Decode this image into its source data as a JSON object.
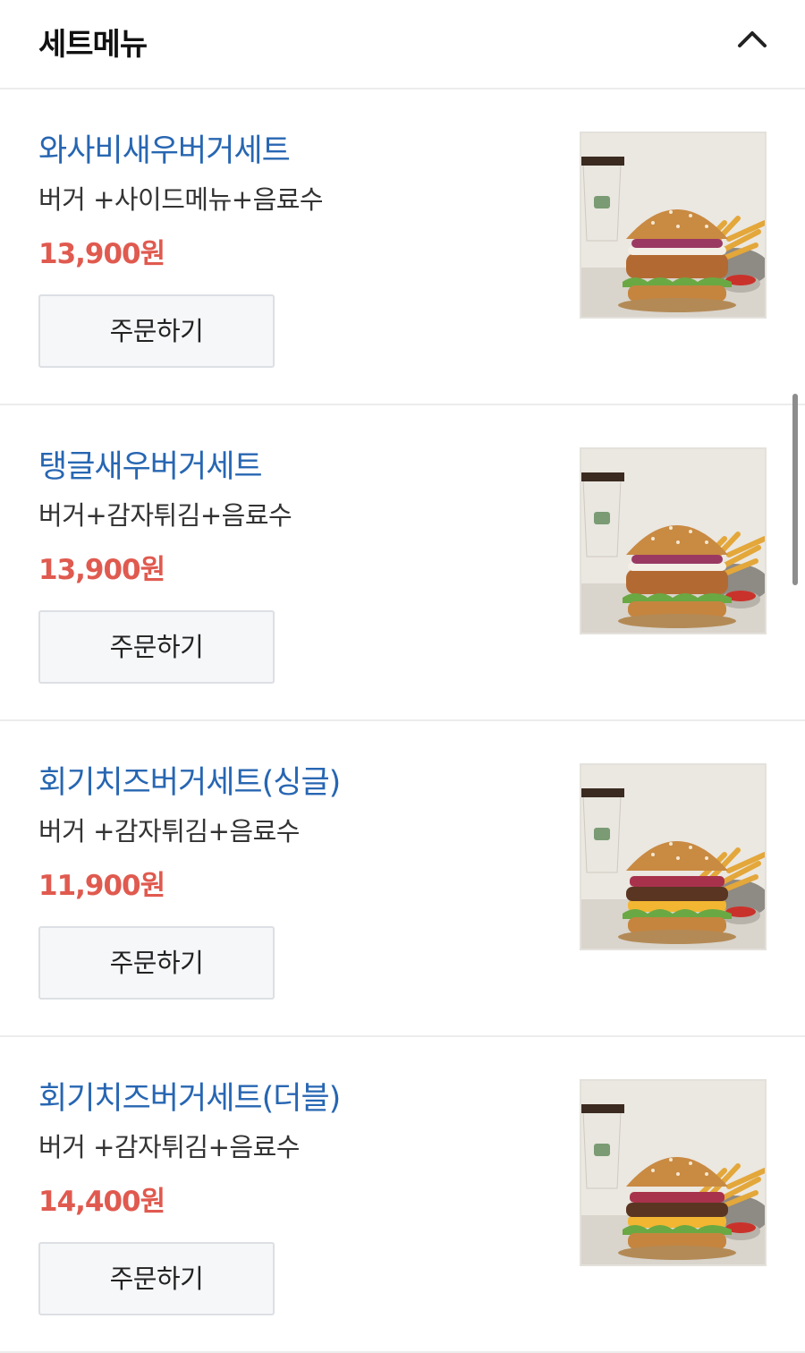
{
  "section": {
    "title": "세트메뉴",
    "collapse_icon": "chevron-up-icon"
  },
  "items": [
    {
      "name": "와사비새우버거세트",
      "desc": "버거 +사이드메뉴+음료수",
      "price": "13,900원",
      "order_label": "주문하기",
      "patty": "shrimp"
    },
    {
      "name": "탱글새우버거세트",
      "desc": "버거+감자튀김+음료수",
      "price": "13,900원",
      "order_label": "주문하기",
      "patty": "shrimp"
    },
    {
      "name": "회기치즈버거세트(싱글)",
      "desc": "버거 +감자튀김+음료수",
      "price": "11,900원",
      "order_label": "주문하기",
      "patty": "cheese"
    },
    {
      "name": "회기치즈버거세트(더블)",
      "desc": "버거 +감자튀김+음료수",
      "price": "14,400원",
      "order_label": "주문하기",
      "patty": "cheese"
    }
  ],
  "colors": {
    "item_name": "#2766b2",
    "price": "#e05a4f",
    "button_bg": "#f6f7f9",
    "divider": "#ececec"
  }
}
